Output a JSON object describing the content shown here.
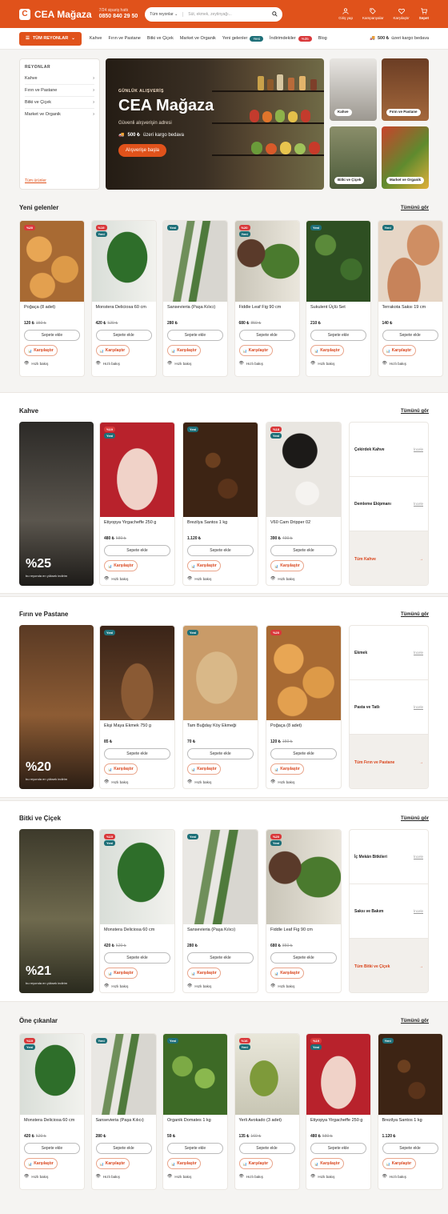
{
  "header": {
    "logo_mark": "C",
    "logo_text": "CEA Mağaza",
    "hotline_label": "7/24 sipariş hattı",
    "hotline_number": "0850 840 29 50",
    "search_category": "Tüm reyonlar",
    "search_placeholder": "Süt, ekmek, zeytinyağı...",
    "actions": [
      "Giriş yap",
      "Kampanyalar",
      "Karşılaştır",
      "Sepet"
    ]
  },
  "nav": {
    "all_departments": "TÜM REYONLAR",
    "links": [
      "Kahve",
      "Fırın ve Pastane",
      "Bitki ve Çiçek",
      "Market ve Organik"
    ],
    "new_label": "Yeni gelenler",
    "new_pill": "Yeni",
    "discount_label": "İndirimdekiler",
    "discount_pill": "%35",
    "blog": "Blog",
    "shipping_amount": "500 ₺",
    "shipping_text": "üzeri kargo bedava"
  },
  "sidebar": {
    "title": "REYONLAR",
    "items": [
      "Kahve",
      "Fırın ve Pastane",
      "Bitki ve Çiçek",
      "Market ve Organik"
    ],
    "all": "Tüm ürünler"
  },
  "hero": {
    "eyebrow": "GÜNLÜK ALIŞVERİŞ",
    "title": "CEA Mağaza",
    "subtitle": "Güvenli alışverişin adresi",
    "ship_amount": "500 ₺",
    "ship_text": "üzeri kargo bedava",
    "cta": "Alışverişe başla",
    "tiles": [
      "Kahve",
      "Fırın ve Pastane",
      "Bitki ve Çiçek",
      "Market ve Organik"
    ]
  },
  "labels": {
    "add_to_cart": "Sepete ekle",
    "compare": "Karşılaştır",
    "quick_view": "Hızlı bakış",
    "see_all": "Tümünü gör",
    "inspect": "İncele",
    "promo_caption": "bu reyonda en yüksek indirim"
  },
  "sections": {
    "new_arrivals": {
      "title": "Yeni gelenler",
      "products": [
        {
          "name": "Poğaça (8 adet)",
          "price": "120 ₺",
          "old": "150 ₺",
          "badges": [
            "%20"
          ]
        },
        {
          "name": "Monstera Deliciosa 60 cm",
          "price": "420 ₺",
          "old": "520 ₺",
          "badges": [
            "%19",
            "Yeni"
          ]
        },
        {
          "name": "Sansevieria (Paşa Kılıcı)",
          "price": "280 ₺",
          "old": "",
          "badges": [
            "Yeni"
          ]
        },
        {
          "name": "Fiddle Leaf Fig 90 cm",
          "price": "680 ₺",
          "old": "850 ₺",
          "badges": [
            "%20",
            "Yeni"
          ]
        },
        {
          "name": "Sukulent Üçlü Set",
          "price": "210 ₺",
          "old": "",
          "badges": [
            "Yeni"
          ]
        },
        {
          "name": "Terrakota Saksı 19 cm",
          "price": "140 ₺",
          "old": "",
          "badges": [
            "Yeni"
          ]
        }
      ]
    },
    "coffee": {
      "title": "Kahve",
      "promo": "%25",
      "products": [
        {
          "name": "Etiyopya Yirgacheffe 250 g",
          "price": "480 ₺",
          "old": "580 ₺",
          "badges": [
            "%19",
            "Yeni"
          ]
        },
        {
          "name": "Brezilya Santos 1 kg",
          "price": "1.120 ₺",
          "old": "",
          "badges": [
            "Yeni"
          ]
        },
        {
          "name": "V60 Cam Dripper 02",
          "price": "390 ₺",
          "old": "490 ₺",
          "badges": [
            "%18",
            "Yeni"
          ]
        }
      ],
      "subcats": [
        "Çekirdek Kahve",
        "Demleme Ekipmanı"
      ],
      "all": "Tüm Kahve"
    },
    "bakery": {
      "title": "Fırın ve Pastane",
      "promo": "%20",
      "products": [
        {
          "name": "Ekşi Maya Ekmek 750 g",
          "price": "85 ₺",
          "old": "",
          "badges": [
            "Yeni"
          ]
        },
        {
          "name": "Tam Buğday Köy Ekmeği",
          "price": "70 ₺",
          "old": "",
          "badges": [
            "Yeni"
          ]
        },
        {
          "name": "Poğaça (8 adet)",
          "price": "120 ₺",
          "old": "150 ₺",
          "badges": [
            "%20"
          ]
        }
      ],
      "subcats": [
        "Ekmek",
        "Pasta ve Tatlı"
      ],
      "all": "Tüm Fırın ve Pastane"
    },
    "plants": {
      "title": "Bitki ve Çiçek",
      "promo": "%21",
      "products": [
        {
          "name": "Monstera Deliciosa 60 cm",
          "price": "420 ₺",
          "old": "520 ₺",
          "badges": [
            "%19",
            "Yeni"
          ]
        },
        {
          "name": "Sansevieria (Paşa Kılıcı)",
          "price": "280 ₺",
          "old": "",
          "badges": [
            "Yeni"
          ]
        },
        {
          "name": "Fiddle Leaf Fig 90 cm",
          "price": "680 ₺",
          "old": "850 ₺",
          "badges": [
            "%20",
            "Yeni"
          ]
        }
      ],
      "subcats": [
        "İç Mekân Bitkileri",
        "Saksı ve Bakım"
      ],
      "all": "Tüm Bitki ve Çiçek"
    },
    "featured": {
      "title": "Öne çıkanlar",
      "products": [
        {
          "name": "Monstera Deliciosa 60 cm",
          "price": "420 ₺",
          "old": "520 ₺",
          "badges": [
            "%19",
            "Yeni"
          ]
        },
        {
          "name": "Sansevieria (Paşa Kılıcı)",
          "price": "280 ₺",
          "old": "",
          "badges": [
            "Yeni"
          ]
        },
        {
          "name": "Organik Domates 1 kg",
          "price": "59 ₺",
          "old": "",
          "badges": [
            "Yeni"
          ]
        },
        {
          "name": "Yerli Avokado (3 adet)",
          "price": "135 ₺",
          "old": "160 ₺",
          "badges": [
            "%16",
            "Yeni"
          ]
        },
        {
          "name": "Etiyopya Yirgacheffe 250 g",
          "price": "480 ₺",
          "old": "580 ₺",
          "badges": [
            "%19",
            "Yeni"
          ]
        },
        {
          "name": "Brezilya Santos 1 kg",
          "price": "1.120 ₺",
          "old": "",
          "badges": [
            "Yeni"
          ]
        }
      ]
    }
  },
  "colors": {
    "brand": "#e0521b",
    "new_badge": "#1e6f78",
    "discount_badge": "#d9383a"
  }
}
